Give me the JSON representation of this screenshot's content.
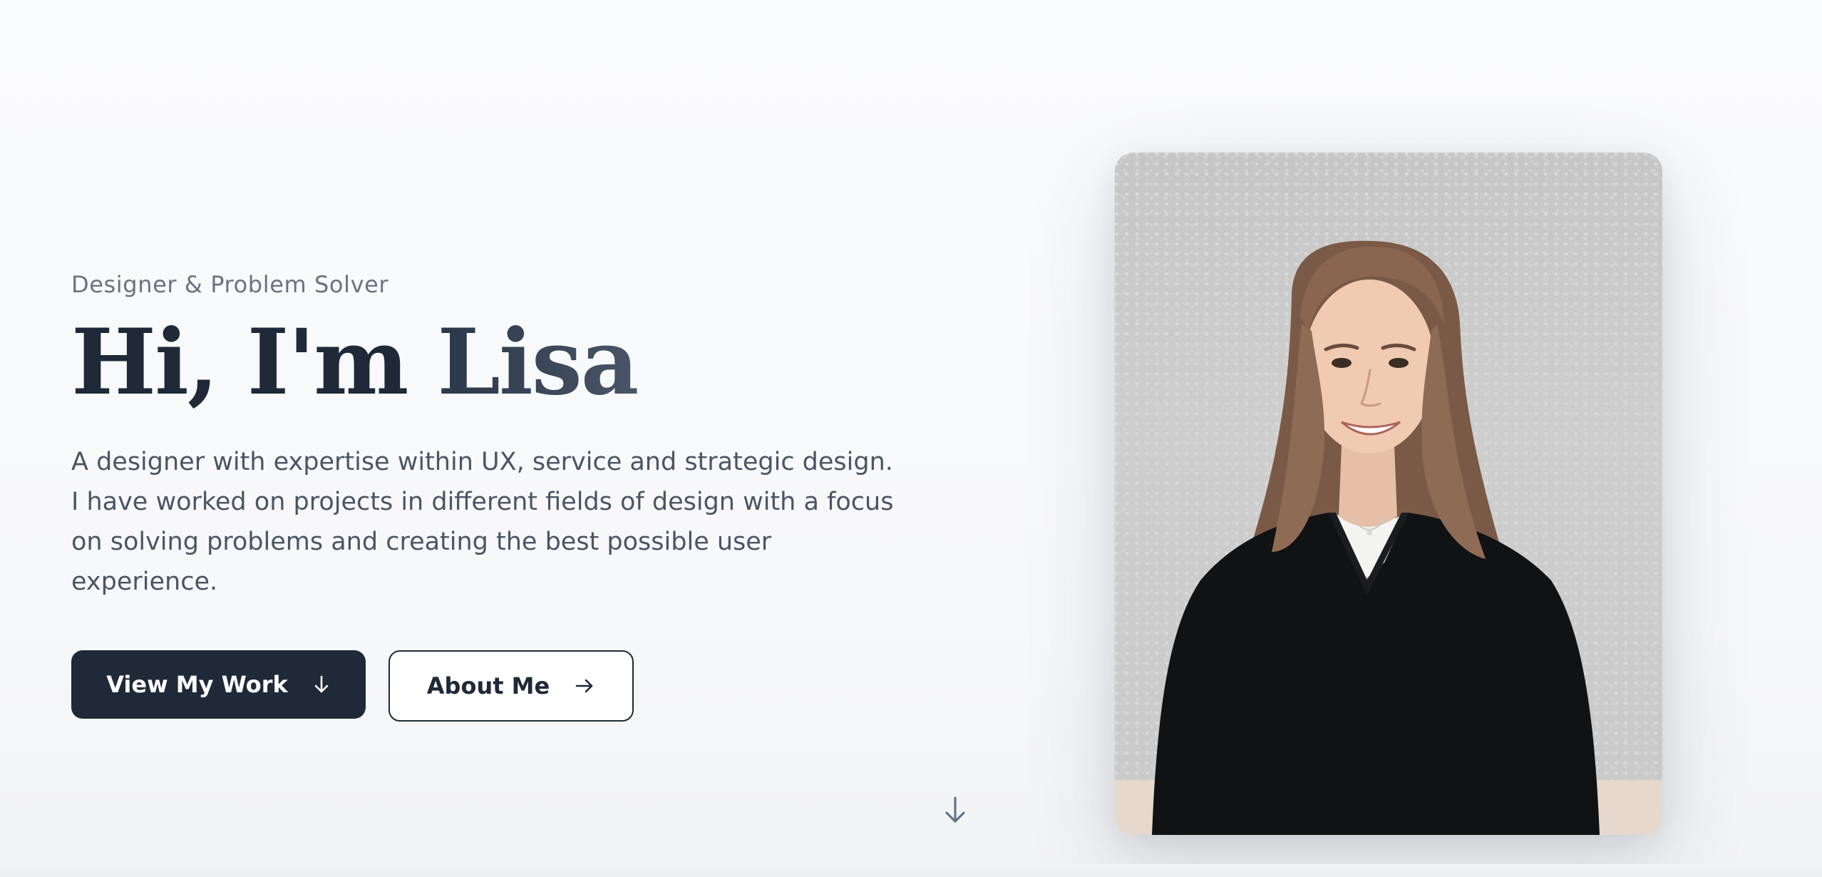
{
  "hero": {
    "eyebrow": "Designer & Problem Solver",
    "headline_prefix": "Hi, I'm ",
    "headline_name": "Lisa",
    "bio": "A designer with expertise within UX, service and strategic design. I have worked on projects in different fields of design with a focus on solving problems and creating the best possible user experience."
  },
  "actions": {
    "primary_label": "View My Work",
    "primary_icon": "arrow-down-icon",
    "secondary_label": "About Me",
    "secondary_icon": "arrow-right-icon"
  },
  "scroll_cue": {
    "icon": "arrow-down-icon"
  },
  "portrait": {
    "alt": "Portrait of Lisa"
  },
  "colors": {
    "primary": "#1f2937",
    "muted": "#6b7280",
    "body_text": "#4b5563",
    "background": "#fafbfc"
  }
}
